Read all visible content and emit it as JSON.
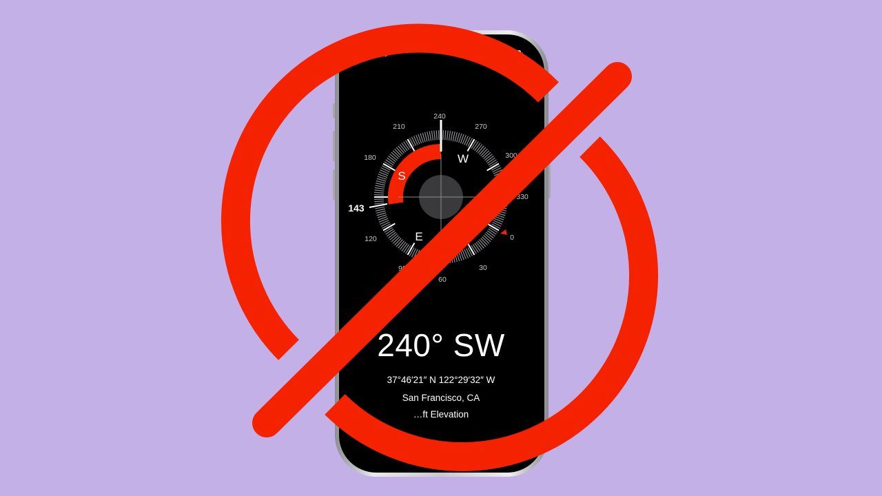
{
  "status_bar": {
    "time": "9:41"
  },
  "compass": {
    "ring_labels": [
      "240",
      "270",
      "300",
      "330",
      "0",
      "30",
      "60",
      "90",
      "120",
      "143",
      "180",
      "210"
    ],
    "cardinals": {
      "w": "W",
      "s": "S",
      "e": "E"
    },
    "current_bearing_label": "143"
  },
  "reading": {
    "heading": "240° SW",
    "coordinates": "37°46′21″ N  122°29′32″ W",
    "location": "San Francisco, CA",
    "elevation": "…ft Elevation"
  },
  "colors": {
    "background": "#c3b0e6",
    "prohibition": "#f52200",
    "accent_red": "#f52200"
  }
}
